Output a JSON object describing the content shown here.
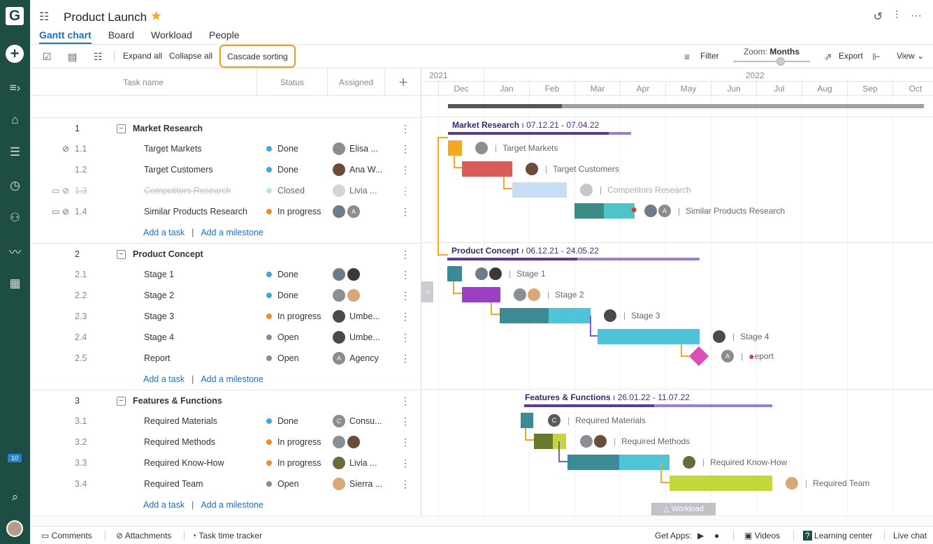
{
  "app": {
    "logo": "G",
    "project_title": "Product Launch",
    "tabs": [
      "Gantt chart",
      "Board",
      "Workload",
      "People"
    ],
    "active_tab": "Gantt chart",
    "notifications_count": "10"
  },
  "toolbar": {
    "expand_all": "Expand all",
    "collapse_all": "Collapse all",
    "cascade_sorting": "Cascade sorting",
    "filter": "Filter",
    "zoom_label": "Zoom:",
    "zoom_value": "Months",
    "export": "Export",
    "view": "View"
  },
  "grid": {
    "headers": {
      "task_name": "Task name",
      "status": "Status",
      "assigned": "Assigned",
      "add": "+"
    },
    "add_task": "Add a task",
    "add_milestone": "Add a milestone",
    "projects": [
      {
        "num": "1",
        "name": "Market Research",
        "tasks": [
          {
            "num": "1.1",
            "name": "Target Markets",
            "status": "Done",
            "assignee": "Elisa ..."
          },
          {
            "num": "1.2",
            "name": "Target Customers",
            "status": "Done",
            "assignee": "Ana W..."
          },
          {
            "num": "1.3",
            "name": "Competitors Research",
            "status": "Closed",
            "assignee": "Livia ..."
          },
          {
            "num": "1.4",
            "name": "Similar Products Research",
            "status": "In progress",
            "assignee": ""
          }
        ]
      },
      {
        "num": "2",
        "name": "Product Concept",
        "tasks": [
          {
            "num": "2.1",
            "name": "Stage 1",
            "status": "Done",
            "assignee": ""
          },
          {
            "num": "2.2",
            "name": "Stage 2",
            "status": "Done",
            "assignee": ""
          },
          {
            "num": "2.3",
            "name": "Stage 3",
            "status": "In progress",
            "assignee": "Umbe..."
          },
          {
            "num": "2.4",
            "name": "Stage 4",
            "status": "Open",
            "assignee": "Umbe..."
          },
          {
            "num": "2.5",
            "name": "Report",
            "status": "Open",
            "assignee": "Agency"
          }
        ]
      },
      {
        "num": "3",
        "name": "Features & Functions",
        "tasks": [
          {
            "num": "3.1",
            "name": "Required Materials",
            "status": "Done",
            "assignee": "Consu..."
          },
          {
            "num": "3.2",
            "name": "Required Methods",
            "status": "In progress",
            "assignee": ""
          },
          {
            "num": "3.3",
            "name": "Required Know-How",
            "status": "In progress",
            "assignee": "Livia ..."
          },
          {
            "num": "3.4",
            "name": "Required Team",
            "status": "Open",
            "assignee": "Sierra ..."
          }
        ]
      }
    ]
  },
  "status_colors": {
    "Done": "#3fa9dc",
    "Closed": "#9fe0c7",
    "In progress": "#f08c2e",
    "Open": "#8c8c8c"
  },
  "timeline": {
    "years": [
      "2021",
      "2022"
    ],
    "months": [
      "Dec",
      "Jan",
      "Feb",
      "Mar",
      "Apr",
      "May",
      "Jun",
      "Jul",
      "Aug",
      "Sep",
      "Oct"
    ],
    "projects": [
      {
        "name": "Market Research",
        "dates": "07.12.21 - 07.04.22"
      },
      {
        "name": "Product Concept",
        "dates": "06.12.21 - 24.05.22"
      },
      {
        "name": "Features & Functions",
        "dates": "26.01.22 - 11.07.22"
      }
    ],
    "labels": {
      "t11": "Target Markets",
      "t12": "Target Customers",
      "t13": "Competitors Research",
      "t14": "Similar Products Research",
      "t21": "Stage 1",
      "t22": "Stage 2",
      "t23": "Stage 3",
      "t24": "Stage 4",
      "t25": "eport",
      "t31": "Required Materials",
      "t32": "Required Methods",
      "t33": "Required Know-How",
      "t34": "Required Team"
    },
    "workload_tab": "Workload"
  },
  "footer": {
    "comments": "Comments",
    "attachments": "Attachments",
    "time_tracker": "Task time tracker",
    "get_apps": "Get Apps:",
    "videos": "Videos",
    "learning_center": "Learning center",
    "live_chat": "Live chat"
  }
}
